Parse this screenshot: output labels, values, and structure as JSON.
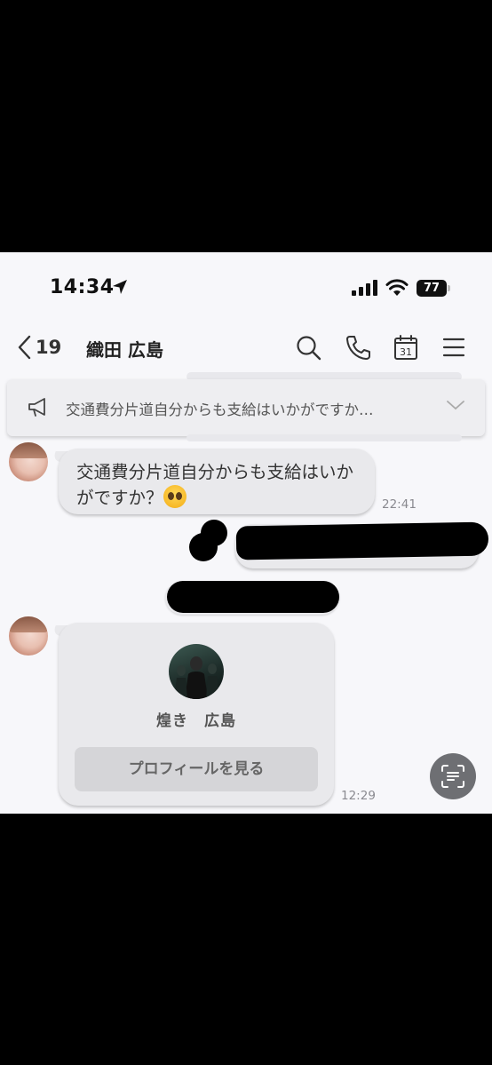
{
  "status_bar": {
    "time": "14:34",
    "battery": "77"
  },
  "header": {
    "back_count": "19",
    "title": "織田 広島"
  },
  "announcement": {
    "text": "交通費分片道自分からも支給はいかがですか…"
  },
  "messages": [
    {
      "text": "交通費分片道自分からも支給はいかがですか？",
      "emoji": "pleading-face",
      "time": "22:41"
    }
  ],
  "profile_card": {
    "name": "煌き　広島",
    "button_label": "プロフィールを見る",
    "time": "12:29"
  },
  "colors": {
    "background": "#f7f7fa",
    "bubble": "#e9e9ec",
    "card_button": "#d5d5d8",
    "fab": "#6e6f73"
  },
  "icons": [
    "location-arrow-icon",
    "signal-icon",
    "wifi-icon",
    "back-chevron-icon",
    "search-icon",
    "phone-icon",
    "calendar-icon",
    "menu-icon",
    "megaphone-icon",
    "chevron-down-icon",
    "scan-text-icon"
  ]
}
